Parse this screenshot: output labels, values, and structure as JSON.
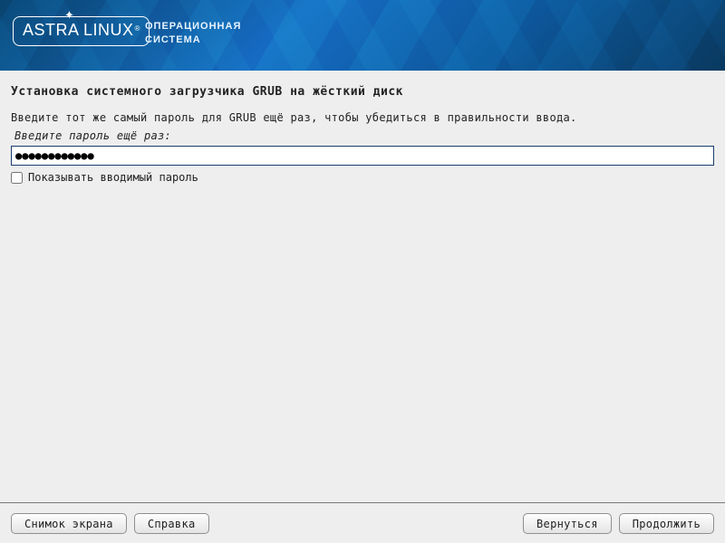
{
  "banner": {
    "logo_text": "ASTRA LINUX",
    "logo_reg": "®",
    "os_line1": "ОПЕРАЦИОННАЯ",
    "os_line2": "СИСТЕМА"
  },
  "main": {
    "title": "Установка системного загрузчика GRUB на жёсткий диск",
    "instruction": "Введите тот же самый пароль для GRUB ещё раз, чтобы убедиться в правильности ввода.",
    "label": "Введите пароль ещё раз:",
    "password_masked": "●●●●●●●●●●●●",
    "show_password_label": "Показывать вводимый пароль",
    "show_password_checked": false
  },
  "footer": {
    "screenshot": "Снимок экрана",
    "help": "Справка",
    "back": "Вернуться",
    "continue": "Продолжить"
  }
}
